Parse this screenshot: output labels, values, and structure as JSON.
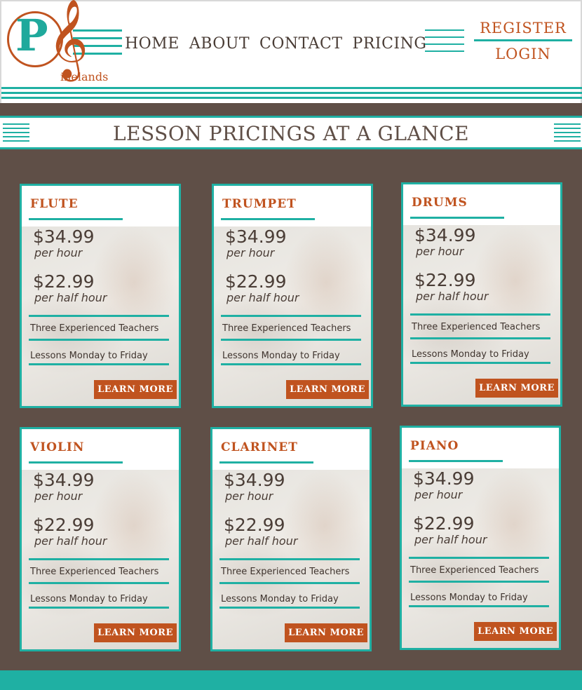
{
  "logo": {
    "initial": "P",
    "clef": "𝄞",
    "text": "inelands"
  },
  "nav": [
    "HOME",
    "ABOUT",
    "CONTACT",
    "PRICING"
  ],
  "auth": {
    "register": "REGISTER",
    "login": "LOGIN"
  },
  "banner": {
    "title": "LESSON PRICINGS AT A GLANCE"
  },
  "cards": [
    {
      "title": "FLUTE",
      "price_hour": "$34.99",
      "unit_hour": "per hour",
      "price_half": "$22.99",
      "unit_half": "per half hour",
      "feature1": "Three Experienced Teachers",
      "feature2": "Lessons Monday to Friday",
      "button": "LEARN MORE"
    },
    {
      "title": "TRUMPET",
      "price_hour": "$34.99",
      "unit_hour": "per hour",
      "price_half": "$22.99",
      "unit_half": "per half hour",
      "feature1": "Three Experienced Teachers",
      "feature2": "Lessons Monday to Friday",
      "button": "LEARN MORE"
    },
    {
      "title": "DRUMS",
      "price_hour": "$34.99",
      "unit_hour": "per hour",
      "price_half": "$22.99",
      "unit_half": "per half hour",
      "feature1": "Three Experienced Teachers",
      "feature2": "Lessons Monday to Friday",
      "button": "LEARN MORE"
    },
    {
      "title": "VIOLIN",
      "price_hour": "$34.99",
      "unit_hour": "per hour",
      "price_half": "$22.99",
      "unit_half": "per half hour",
      "feature1": "Three Experienced Teachers",
      "feature2": "Lessons Monday to Friday",
      "button": "LEARN MORE"
    },
    {
      "title": "CLARINET",
      "price_hour": "$34.99",
      "unit_hour": "per hour",
      "price_half": "$22.99",
      "unit_half": "per half hour",
      "feature1": "Three Experienced Teachers",
      "feature2": "Lessons Monday to Friday",
      "button": "LEARN MORE"
    },
    {
      "title": "PIANO",
      "price_hour": "$34.99",
      "unit_hour": "per hour",
      "price_half": "$22.99",
      "unit_half": "per half hour",
      "feature1": "Three Experienced Teachers",
      "feature2": "Lessons Monday to Friday",
      "button": "LEARN MORE"
    }
  ],
  "colors": {
    "teal": "#1fb0a3",
    "orange": "#c0531f",
    "brown": "#5f4f47"
  }
}
